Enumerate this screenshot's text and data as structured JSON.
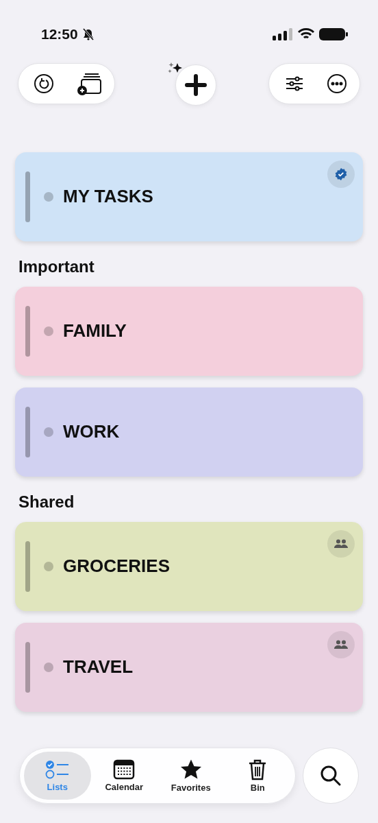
{
  "status_bar": {
    "time": "12:50",
    "silenced": true
  },
  "sections": [
    {
      "cards": [
        {
          "title": "MY TASKS",
          "color": "#cfe3f7",
          "kind": "verified"
        }
      ]
    },
    {
      "heading": "Important",
      "cards": [
        {
          "title": "FAMILY",
          "color": "#f4cfdc",
          "kind": "plain"
        },
        {
          "title": "WORK",
          "color": "#d1d1f1",
          "kind": "plain"
        }
      ]
    },
    {
      "heading": "Shared",
      "cards": [
        {
          "title": "GROCERIES",
          "color": "#e0e5bd",
          "kind": "shared"
        },
        {
          "title": "TRAVEL",
          "color": "#ead0e0",
          "kind": "shared"
        }
      ]
    }
  ],
  "tab_bar": {
    "tabs": [
      {
        "label": "Lists",
        "selected": true
      },
      {
        "label": "Calendar",
        "selected": false
      },
      {
        "label": "Favorites",
        "selected": false
      },
      {
        "label": "Bin",
        "selected": false
      }
    ]
  }
}
